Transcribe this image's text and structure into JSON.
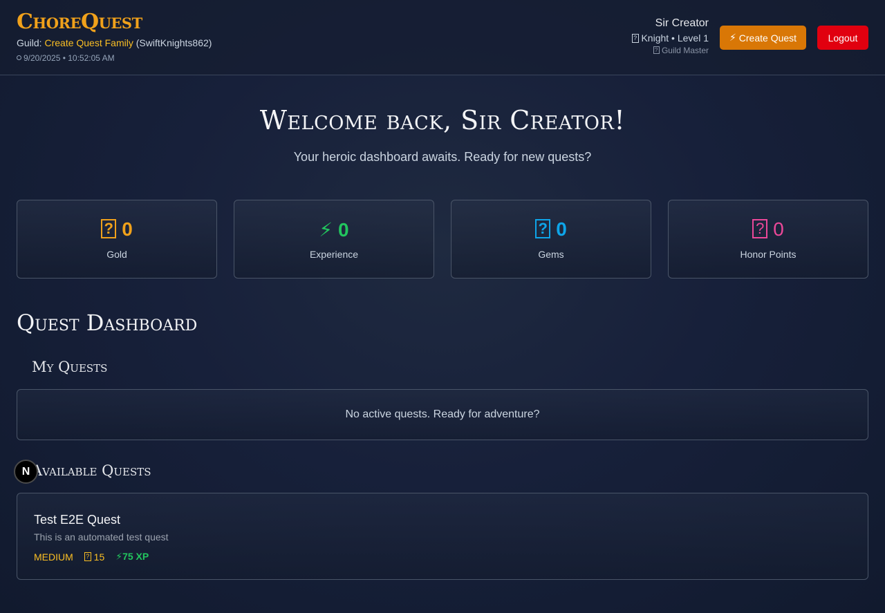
{
  "header": {
    "logo": "ChoreQuest",
    "guild_prefix": "Guild: ",
    "guild_name": "Create Quest Family",
    "guild_code": "(SwiftKnights862)",
    "timestamp": "9/20/2025 • 10:52:05 AM",
    "user_name": "Sir Creator",
    "user_class": "Knight • Level 1",
    "user_role": "Guild Master",
    "create_quest_label": "Create Quest",
    "logout_label": "Logout"
  },
  "welcome": {
    "title": "Welcome back, Sir Creator!",
    "subtitle": "Your heroic dashboard awaits. Ready for new quests?"
  },
  "stats": [
    {
      "value": "0",
      "label": "Gold",
      "color": "#f0a11b",
      "icon": "coin-icon"
    },
    {
      "value": "0",
      "label": "Experience",
      "color": "#22c55e",
      "icon": "lightning-icon"
    },
    {
      "value": "0",
      "label": "Gems",
      "color": "#0ea5e9",
      "icon": "gem-icon"
    },
    {
      "value": "0",
      "label": "Honor Points",
      "color": "#ec4899",
      "icon": "medal-icon"
    }
  ],
  "dashboard": {
    "title": "Quest Dashboard",
    "my_quests_title": "My Quests",
    "my_quests_empty": "No active quests. Ready for adventure?",
    "available_title": "Available Quests",
    "available": [
      {
        "title": "Test E2E Quest",
        "description": "This is an automated test quest",
        "difficulty": "MEDIUM",
        "gold": "15",
        "xp": "75 XP"
      }
    ]
  },
  "dev_badge": "N"
}
